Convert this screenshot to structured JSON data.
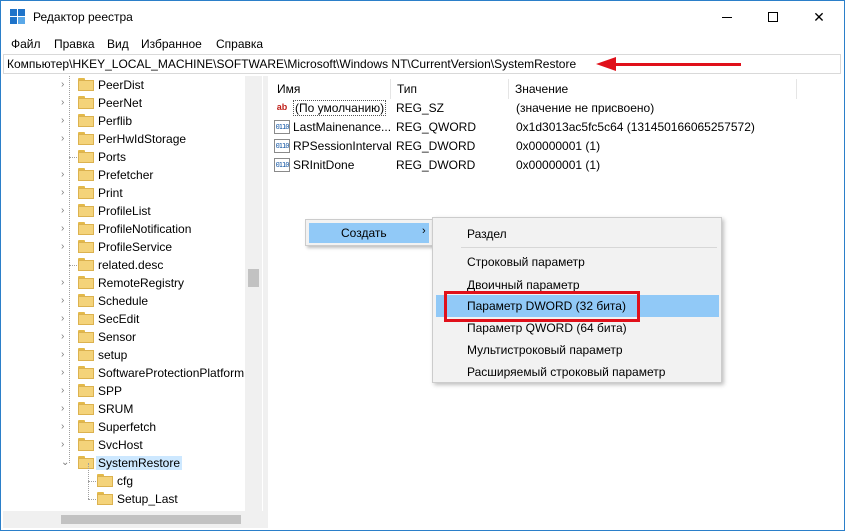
{
  "window": {
    "title": "Редактор реестра"
  },
  "menu": [
    "Файл",
    "Правка",
    "Вид",
    "Избранное",
    "Справка"
  ],
  "address": "Компьютер\\HKEY_LOCAL_MACHINE\\SOFTWARE\\Microsoft\\Windows NT\\CurrentVersion\\SystemRestore",
  "tree": {
    "items": [
      {
        "label": "PeerDist",
        "expandable": true
      },
      {
        "label": "PeerNet",
        "expandable": true
      },
      {
        "label": "Perflib",
        "expandable": true
      },
      {
        "label": "PerHwIdStorage",
        "expandable": true
      },
      {
        "label": "Ports",
        "expandable": false
      },
      {
        "label": "Prefetcher",
        "expandable": true
      },
      {
        "label": "Print",
        "expandable": true
      },
      {
        "label": "ProfileList",
        "expandable": true
      },
      {
        "label": "ProfileNotification",
        "expandable": true
      },
      {
        "label": "ProfileService",
        "expandable": true
      },
      {
        "label": "related.desc",
        "expandable": false
      },
      {
        "label": "RemoteRegistry",
        "expandable": true
      },
      {
        "label": "Schedule",
        "expandable": true
      },
      {
        "label": "SecEdit",
        "expandable": true
      },
      {
        "label": "Sensor",
        "expandable": true
      },
      {
        "label": "setup",
        "expandable": true
      },
      {
        "label": "SoftwareProtectionPlatform",
        "expandable": true
      },
      {
        "label": "SPP",
        "expandable": true
      },
      {
        "label": "SRUM",
        "expandable": true
      },
      {
        "label": "Superfetch",
        "expandable": true
      },
      {
        "label": "SvcHost",
        "expandable": true
      },
      {
        "label": "SystemRestore",
        "expandable": true,
        "expanded": true,
        "selected": true
      },
      {
        "label": "cfg",
        "child": true
      },
      {
        "label": "Setup_Last",
        "child": true
      }
    ]
  },
  "columns": {
    "name": "Имя",
    "type": "Тип",
    "value": "Значение"
  },
  "values": [
    {
      "name": "(По умолчанию)",
      "type": "REG_SZ",
      "data": "(значение не присвоено)",
      "icon": "string-value-icon"
    },
    {
      "name": "LastMainenance...",
      "type": "REG_QWORD",
      "data": "0x1d3013ac5fc5c64 (131450166065257572)",
      "icon": "binary-value-icon"
    },
    {
      "name": "RPSessionInterval",
      "type": "REG_DWORD",
      "data": "0x00000001 (1)",
      "icon": "binary-value-icon"
    },
    {
      "name": "SRInitDone",
      "type": "REG_DWORD",
      "data": "0x00000001 (1)",
      "icon": "binary-value-icon"
    }
  ],
  "context_menu": {
    "create_label": "Создать",
    "arrow": "›"
  },
  "submenu": {
    "items": [
      "Раздел",
      "Строковый параметр",
      "Двоичный параметр",
      "Параметр DWORD (32 бита)",
      "Параметр QWORD (64 бита)",
      "Мультистроковый параметр",
      "Расширяемый строковый параметр"
    ],
    "highlighted_index": 3
  },
  "colors": {
    "accent": "#91c9f7",
    "annotation": "#e0101a",
    "folder": "#f4d37a"
  }
}
